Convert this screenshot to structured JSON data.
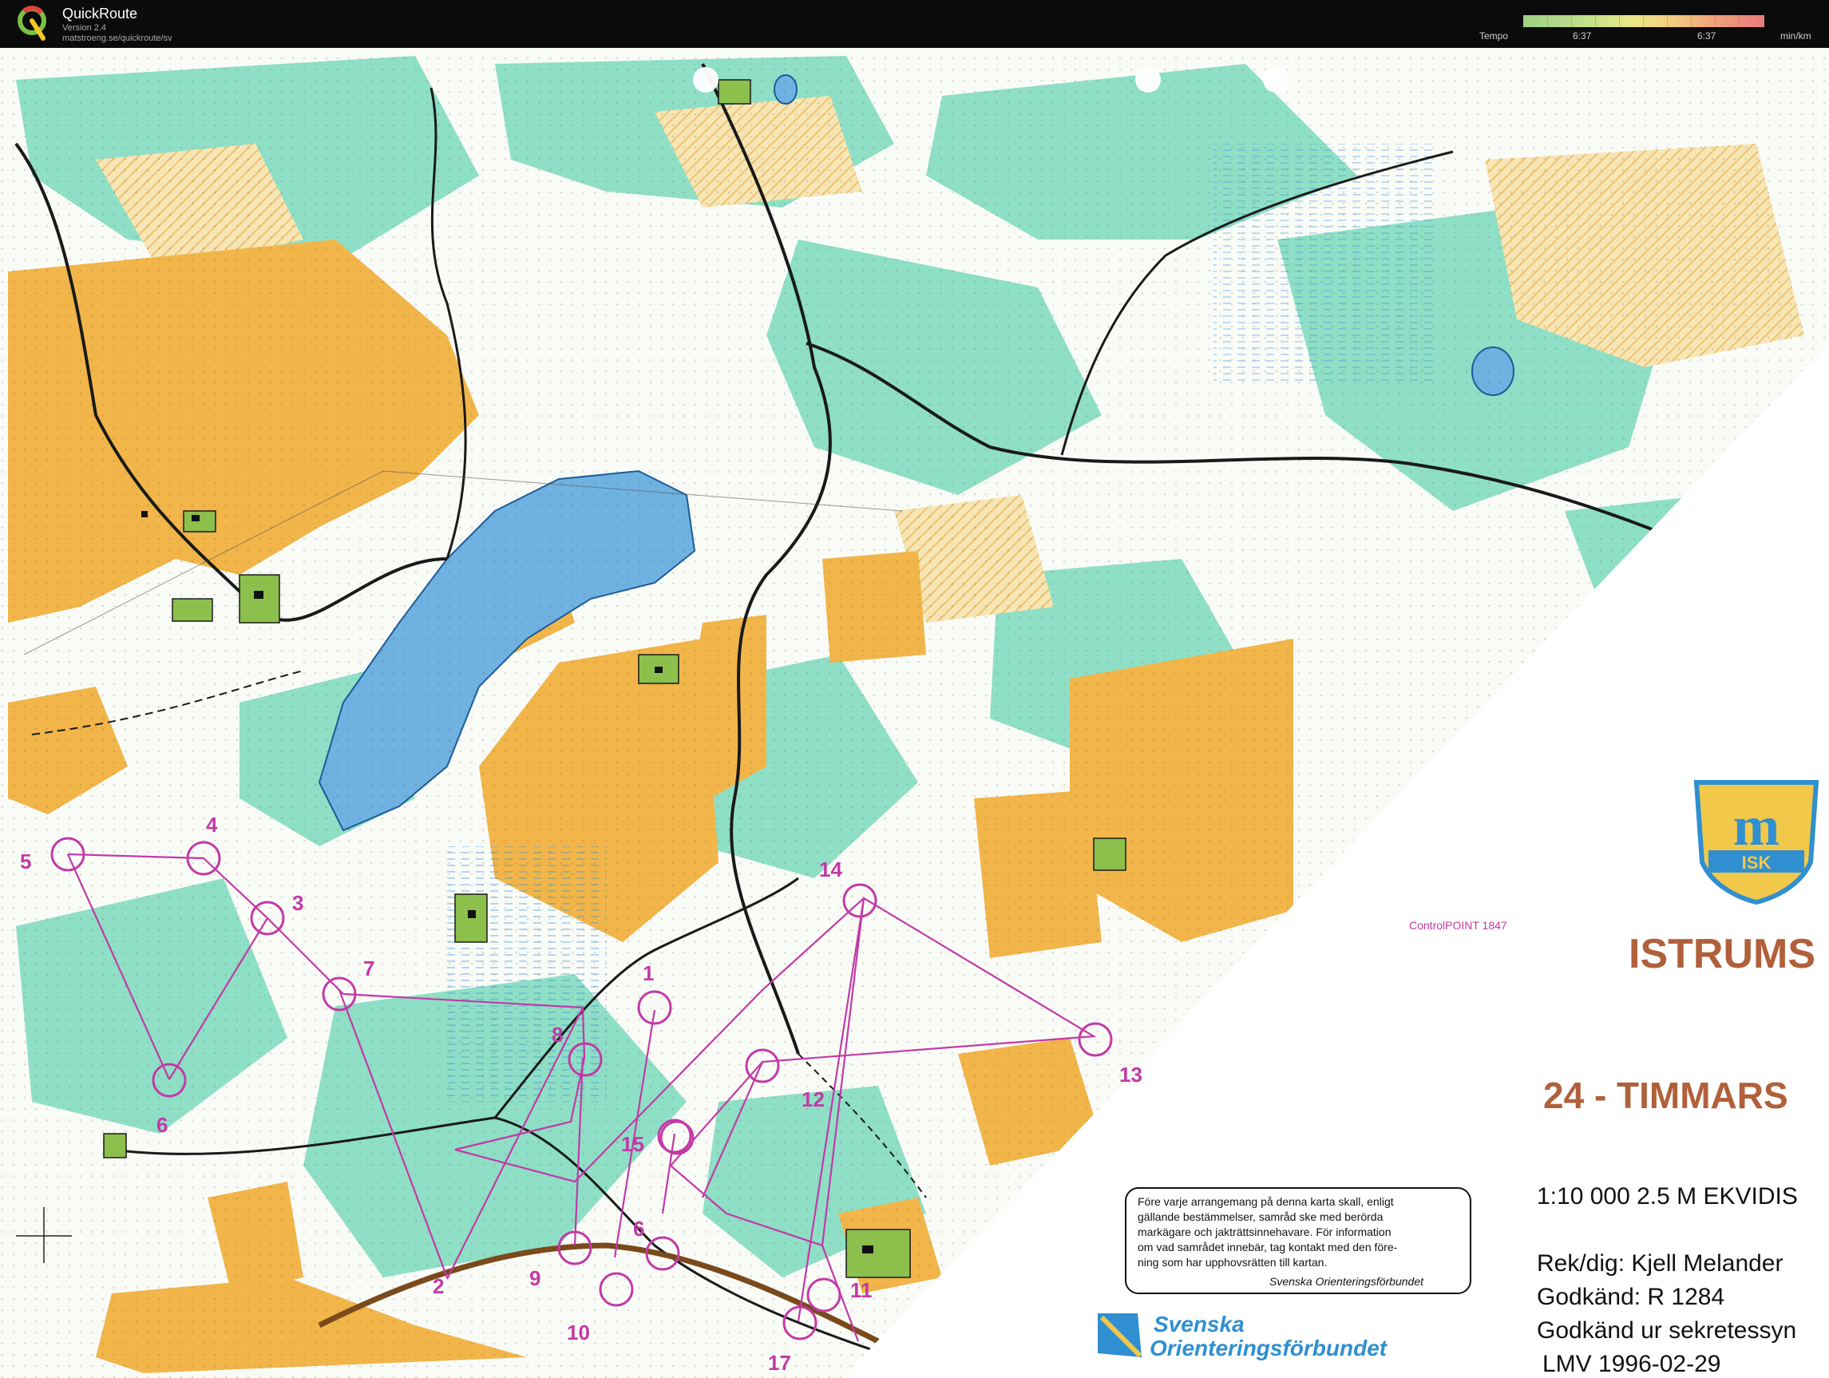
{
  "app": {
    "title": "QuickRoute",
    "version": "Version 2.4",
    "url": "matstroeng.se/quickroute/sv"
  },
  "tempo_legend": {
    "label": "Tempo",
    "value_left": "6:37",
    "value_right": "6:37",
    "unit": "min/km"
  },
  "map": {
    "club_name": "ISTRUMS",
    "club_logo_text": "ISK",
    "event_title": "24 - TIMMARS",
    "scale_line": "1:10 000  2.5 M EKVIDIS",
    "rek_dig": "Rek/dig: Kjell Melander",
    "godkand": "Godkänd: R 1284",
    "godkand_ur": "Godkänd ur sekretessyn",
    "lmv": "LMV 1996-02-29",
    "controlpoint": "ControlPOINT 1847",
    "notice_lines": [
      "Före varje arrangemang på denna karta skall, enligt",
      "gällande bestämmelser, samråd ske med berörda",
      "markägare och jakträttsinnehavare. För information",
      "om vad samrådet innebär, tag kontakt med den före-",
      "ning som har upphovsrätten till kartan."
    ],
    "notice_signature": "Svenska Orienteringsförbundet",
    "federation_line1": "Svenska",
    "federation_line2": "Orienteringsförbundet",
    "controls": [
      {
        "label": "1"
      },
      {
        "label": "2"
      },
      {
        "label": "3"
      },
      {
        "label": "4"
      },
      {
        "label": "5"
      },
      {
        "label": "6"
      },
      {
        "label": "6"
      },
      {
        "label": "7"
      },
      {
        "label": "8"
      },
      {
        "label": "9"
      },
      {
        "label": "10"
      },
      {
        "label": "11"
      },
      {
        "label": "12"
      },
      {
        "label": "13"
      },
      {
        "label": "14"
      },
      {
        "label": "15"
      },
      {
        "label": "17"
      }
    ]
  },
  "colors": {
    "open_land": "#f1b54a",
    "forest_green": "#66d9b8",
    "water": "#6fb1e0",
    "course": "#c23aa6",
    "title_brown": "#b0603a"
  }
}
